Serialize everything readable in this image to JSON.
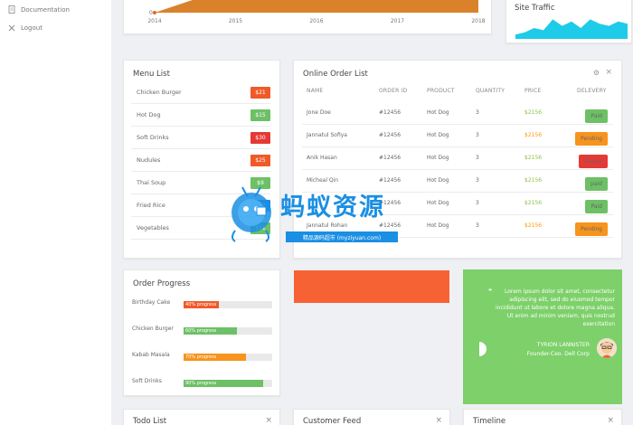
{
  "sidebar": {
    "items": [
      {
        "label": "Documentation",
        "icon": "document-icon"
      },
      {
        "label": "Logout",
        "icon": "close-icon"
      }
    ]
  },
  "sales_chart": {
    "chart_data": {
      "type": "area",
      "x": [
        "2014",
        "2015",
        "2016",
        "2017",
        "2018"
      ],
      "series": [
        {
          "values": [
            0,
            12,
            13,
            13,
            14
          ]
        }
      ],
      "y_tick_visible": "0",
      "colors": {
        "fill": "#d9822b",
        "line": "#e36a2b"
      }
    }
  },
  "site_traffic": {
    "title": "Site Traffic",
    "chart_data": {
      "type": "area",
      "values": [
        2,
        3,
        5,
        4,
        9,
        6,
        8,
        5,
        9,
        7,
        6,
        8,
        7
      ],
      "colors": {
        "fill": "#1ecbe8"
      }
    }
  },
  "menu_list": {
    "title": "Menu List",
    "items": [
      {
        "name": "Chicken Burger",
        "price": "$21",
        "color": "#f05a28"
      },
      {
        "name": "Hot Dog",
        "price": "$15",
        "color": "#6dc066"
      },
      {
        "name": "Soft Drinks",
        "price": "$30",
        "color": "#e53935"
      },
      {
        "name": "Nudules",
        "price": "$25",
        "color": "#f05a28"
      },
      {
        "name": "Thai Soup",
        "price": "$9",
        "color": "#6dc066"
      },
      {
        "name": "Fried Rice",
        "price": "$12",
        "color": "#1e88e5"
      },
      {
        "name": "Vegetables",
        "price": "$11",
        "color": "#6dc066"
      }
    ]
  },
  "online_orders": {
    "title": "Online Order List",
    "headers": [
      "NAME",
      "ORDER ID",
      "PRODUCT",
      "QUANTITY",
      "PRICE",
      "DELEVERY"
    ],
    "rows": [
      {
        "name": "Jone Doe",
        "id": "#12456",
        "product": "Hot Dog",
        "qty": "3",
        "price": "$2156",
        "price_color": "green",
        "status": "Paid",
        "status_color": "#6dc066"
      },
      {
        "name": "Jannatul Sofiya",
        "id": "#12456",
        "product": "Hot Dog",
        "qty": "3",
        "price": "$2156",
        "price_color": "orange",
        "status": "Pending",
        "status_color": "#f7941d"
      },
      {
        "name": "Anik Hasan",
        "id": "#12456",
        "product": "Hot Dog",
        "qty": "3",
        "price": "$2156",
        "price_color": "green",
        "status": "Cancel",
        "status_color": "#e53935"
      },
      {
        "name": "Micheal Qin",
        "id": "#12456",
        "product": "Hot Dog",
        "qty": "3",
        "price": "$2156",
        "price_color": "green",
        "status": "paid",
        "status_color": "#6dc066"
      },
      {
        "name": "",
        "id": "#12456",
        "product": "Hot Dog",
        "qty": "3",
        "price": "$2156",
        "price_color": "green",
        "status": "Paid",
        "status_color": "#6dc066"
      },
      {
        "name": "Jannatul Rohan",
        "id": "#12456",
        "product": "Hot Dog",
        "qty": "3",
        "price": "$2156",
        "price_color": "orange",
        "status": "Pending",
        "status_color": "#f7941d"
      }
    ]
  },
  "order_progress": {
    "title": "Order Progress",
    "items": [
      {
        "label": "Birthday Cake",
        "progress_text": "40% progress",
        "percent": 40,
        "color": "#f05a28"
      },
      {
        "label": "Chicken Burger",
        "progress_text": "60% progress",
        "percent": 60,
        "color": "#6dc066"
      },
      {
        "label": "Kabab Masala",
        "progress_text": "70% progress",
        "percent": 70,
        "color": "#f7941d"
      },
      {
        "label": "Soft Drinks",
        "progress_text": "90% progress",
        "percent": 90,
        "color": "#6dc066"
      }
    ]
  },
  "testimonial": {
    "text": "Lorem ipsum dolor sit amet, consectetur adipiscing elit, sed do eiusmod tempor incididunt ut labore et dolore magna aliqua. Ut enim ad minim veniam, quis nostrud exercitation",
    "name": "TYRION LANNISTER",
    "role": "Founder-Ceo. Dell Corp",
    "color": "#7dd06a"
  },
  "orange_block_color": "#f76234",
  "bottom_cards": {
    "todo": "Todo List",
    "feed": "Customer Feed",
    "timeline": "Timeline"
  },
  "watermark": {
    "title": "蚂蚁资源",
    "subtitle": "精品源码超市 (myziyuan.com)"
  }
}
